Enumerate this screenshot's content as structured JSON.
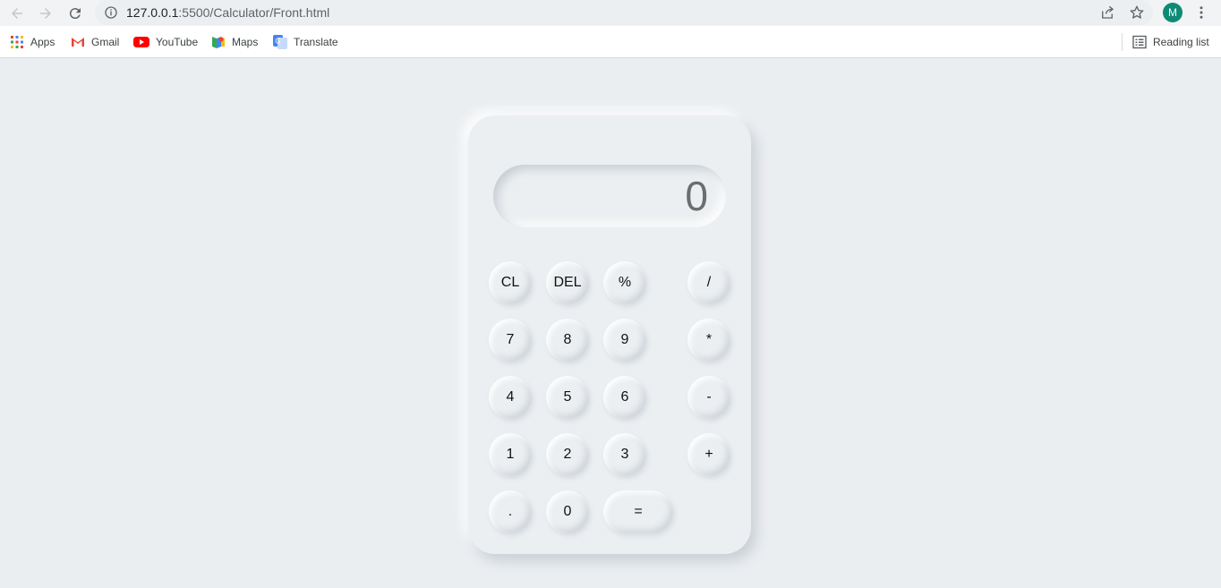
{
  "browser": {
    "url_host": "127.0.0.1",
    "url_path": ":5500/Calculator/Front.html",
    "profile_initial": "M",
    "accent_color": "#0f8a74"
  },
  "bookmarks": {
    "items": [
      {
        "label": "Apps",
        "icon": "apps-grid-icon"
      },
      {
        "label": "Gmail",
        "icon": "gmail-icon"
      },
      {
        "label": "YouTube",
        "icon": "youtube-icon"
      },
      {
        "label": "Maps",
        "icon": "maps-icon"
      },
      {
        "label": "Translate",
        "icon": "translate-icon"
      }
    ],
    "reading_list": "Reading list"
  },
  "calculator": {
    "display": "0",
    "keys": {
      "cl": "CL",
      "del": "DEL",
      "percent": "%",
      "divide": "/",
      "seven": "7",
      "eight": "8",
      "nine": "9",
      "multiply": "*",
      "four": "4",
      "five": "5",
      "six": "6",
      "minus": "-",
      "one": "1",
      "two": "2",
      "three": "3",
      "plus": "+",
      "dot": ".",
      "zero": "0",
      "equals": "="
    }
  }
}
